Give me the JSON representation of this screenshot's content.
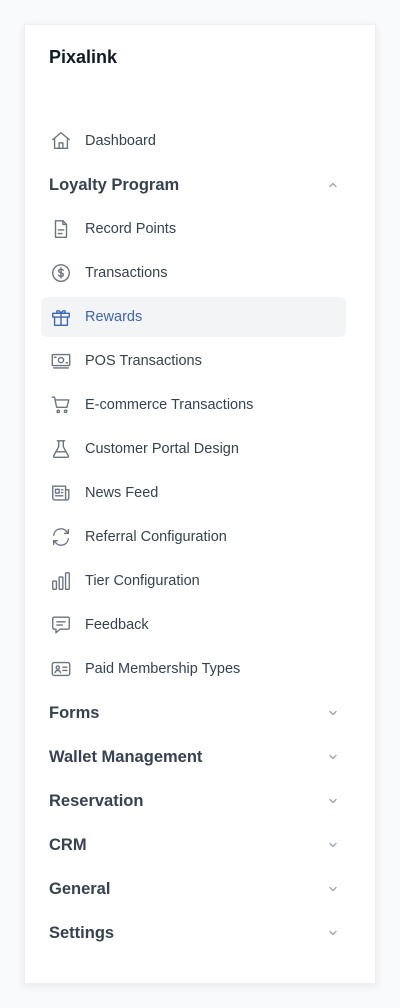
{
  "app": {
    "name": "Pixalink"
  },
  "sidebar": {
    "top_items": [
      {
        "label": "Dashboard",
        "icon": "home-icon"
      }
    ],
    "sections": [
      {
        "label": "Loyalty Program",
        "expanded": true,
        "items": [
          {
            "label": "Record Points",
            "icon": "document-icon"
          },
          {
            "label": "Transactions",
            "icon": "dollar-circle-icon"
          },
          {
            "label": "Rewards",
            "icon": "gift-icon",
            "active": true
          },
          {
            "label": "POS Transactions",
            "icon": "cash-icon"
          },
          {
            "label": "E-commerce Transactions",
            "icon": "shopping-cart-icon"
          },
          {
            "label": "Customer Portal Design",
            "icon": "beaker-icon"
          },
          {
            "label": "News Feed",
            "icon": "newspaper-icon"
          },
          {
            "label": "Referral Configuration",
            "icon": "refresh-icon"
          },
          {
            "label": "Tier Configuration",
            "icon": "bar-chart-icon"
          },
          {
            "label": "Feedback",
            "icon": "chat-icon"
          },
          {
            "label": "Paid Membership Types",
            "icon": "id-card-icon"
          }
        ]
      },
      {
        "label": "Forms",
        "expanded": false
      },
      {
        "label": "Wallet Management",
        "expanded": false
      },
      {
        "label": "Reservation",
        "expanded": false
      },
      {
        "label": "CRM",
        "expanded": false
      },
      {
        "label": "General",
        "expanded": false
      },
      {
        "label": "Settings",
        "expanded": false
      }
    ]
  },
  "colors": {
    "active_accent": "#3b66b3",
    "active_background": "#f3f4f6",
    "text": "#374151",
    "icon": "#6b7280"
  }
}
